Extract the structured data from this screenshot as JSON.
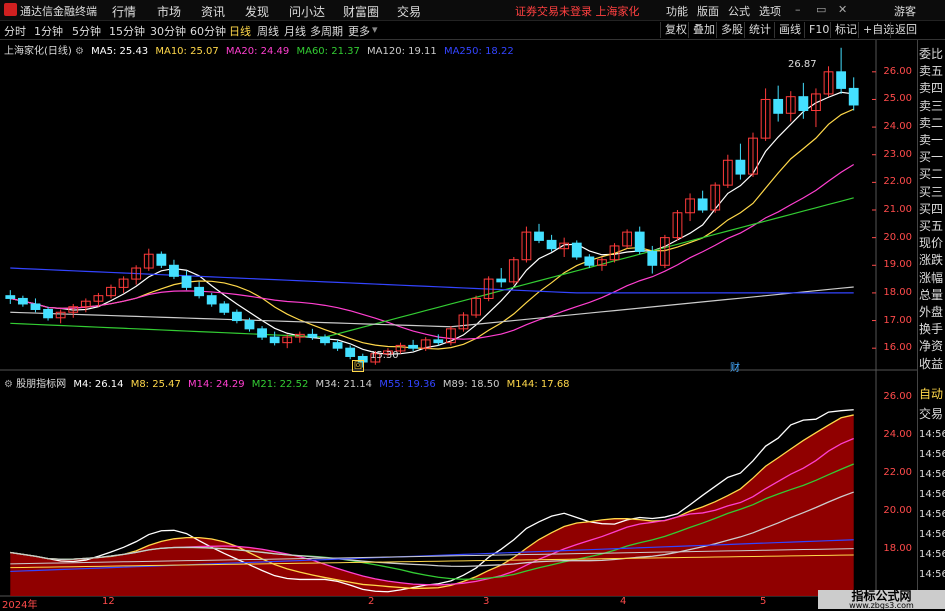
{
  "app": {
    "name": "通达信金融终端",
    "menu": [
      "行情",
      "市场",
      "资讯",
      "发现",
      "问小达",
      "财富圈",
      "交易"
    ],
    "notice": "证券交易未登录  上海家化",
    "right_menu": [
      "功能",
      "版面",
      "公式",
      "选项"
    ],
    "guest": "游客"
  },
  "toolbar": {
    "periods": [
      "分时",
      "1分钟",
      "5分钟",
      "15分钟",
      "30分钟",
      "60分钟",
      "日线",
      "周线",
      "月线",
      "多周期",
      "更多"
    ],
    "active_period": "日线",
    "buttons": [
      "复权",
      "叠加",
      "多股",
      "统计",
      "画线",
      "F10",
      "标记",
      "+自选",
      "返回"
    ]
  },
  "main_chart": {
    "stock": "上海家化(日线)",
    "ma_labels": [
      {
        "text": "MA5: 25.43",
        "color": "#ffffff"
      },
      {
        "text": "MA10: 25.07",
        "color": "#ffd84a"
      },
      {
        "text": "MA20: 24.49",
        "color": "#ff3fd0"
      },
      {
        "text": "MA60: 21.37",
        "color": "#33cc33"
      },
      {
        "text": "MA120: 19.11",
        "color": "#cccccc"
      },
      {
        "text": "MA250: 18.22",
        "color": "#3344ff"
      }
    ],
    "high_label": "26.87",
    "low_label": "15.30",
    "cai_label": "财",
    "y_ticks": [
      "26.00",
      "25.00",
      "24.00",
      "23.00",
      "22.00",
      "21.00",
      "20.00",
      "19.00",
      "18.00",
      "17.00",
      "16.00"
    ]
  },
  "indicator": {
    "name": "股朋指标网",
    "labels": [
      {
        "text": "M4: 26.14",
        "color": "#ffffff"
      },
      {
        "text": "M8: 25.47",
        "color": "#ffd84a"
      },
      {
        "text": "M14: 24.29",
        "color": "#ff3fd0"
      },
      {
        "text": "M21: 22.52",
        "color": "#33cc33"
      },
      {
        "text": "M34: 21.14",
        "color": "#cccccc"
      },
      {
        "text": "M55: 19.36",
        "color": "#3344ff"
      },
      {
        "text": "M89: 18.50",
        "color": "#cccccc"
      },
      {
        "text": "M144: 17.68",
        "color": "#ffd84a"
      }
    ],
    "y_ticks": [
      "26.00",
      "24.00",
      "22.00",
      "20.00",
      "18.00"
    ]
  },
  "x_axis": [
    "2024年",
    "12",
    "2",
    "3",
    "4",
    "5"
  ],
  "side_panel": [
    "委比",
    "卖五",
    "卖四",
    "卖三",
    "卖二",
    "卖一",
    "买一",
    "买二",
    "买三",
    "买四",
    "买五",
    "现价",
    "涨跌",
    "涨幅",
    "总量",
    "外盘",
    "换手",
    "净资",
    "收益"
  ],
  "side_panel2": [
    "自动",
    "交易",
    "14:56",
    "14:56",
    "14:56",
    "14:56",
    "14:56",
    "14:56",
    "14:56",
    "14:56"
  ],
  "watermark": {
    "line1": "指标公式网",
    "line2": "www.zbgs3.com"
  },
  "colors": {
    "up": "#ff3b3b",
    "down": "#44e0ff",
    "axis": "#ff4b4b"
  },
  "chart_data": {
    "type": "line",
    "title": "",
    "x_start": "2024-11-01",
    "candles": [
      [
        17.9,
        18.1,
        17.6,
        17.8
      ],
      [
        17.8,
        17.9,
        17.5,
        17.6
      ],
      [
        17.6,
        17.8,
        17.3,
        17.4
      ],
      [
        17.4,
        17.5,
        17.0,
        17.1
      ],
      [
        17.1,
        17.4,
        16.9,
        17.3
      ],
      [
        17.3,
        17.6,
        17.1,
        17.5
      ],
      [
        17.5,
        17.8,
        17.3,
        17.7
      ],
      [
        17.7,
        18.0,
        17.5,
        17.9
      ],
      [
        17.9,
        18.3,
        17.8,
        18.2
      ],
      [
        18.2,
        18.6,
        18.0,
        18.5
      ],
      [
        18.5,
        19.0,
        18.3,
        18.9
      ],
      [
        18.9,
        19.6,
        18.8,
        19.4
      ],
      [
        19.4,
        19.5,
        18.9,
        19.0
      ],
      [
        19.0,
        19.2,
        18.5,
        18.6
      ],
      [
        18.6,
        18.8,
        18.1,
        18.2
      ],
      [
        18.2,
        18.4,
        17.8,
        17.9
      ],
      [
        17.9,
        18.0,
        17.5,
        17.6
      ],
      [
        17.6,
        17.7,
        17.2,
        17.3
      ],
      [
        17.3,
        17.4,
        16.9,
        17.0
      ],
      [
        17.0,
        17.1,
        16.6,
        16.7
      ],
      [
        16.7,
        16.8,
        16.3,
        16.4
      ],
      [
        16.4,
        16.6,
        16.1,
        16.2
      ],
      [
        16.2,
        16.5,
        16.0,
        16.4
      ],
      [
        16.4,
        16.6,
        16.2,
        16.5
      ],
      [
        16.5,
        16.7,
        16.3,
        16.4
      ],
      [
        16.4,
        16.5,
        16.1,
        16.2
      ],
      [
        16.2,
        16.3,
        15.9,
        16.0
      ],
      [
        16.0,
        16.1,
        15.6,
        15.7
      ],
      [
        15.7,
        15.8,
        15.3,
        15.5
      ],
      [
        15.5,
        15.9,
        15.4,
        15.8
      ],
      [
        15.8,
        16.0,
        15.7,
        15.9
      ],
      [
        15.9,
        16.2,
        15.8,
        16.1
      ],
      [
        16.1,
        16.3,
        15.9,
        16.0
      ],
      [
        16.0,
        16.4,
        15.9,
        16.3
      ],
      [
        16.3,
        16.5,
        16.1,
        16.2
      ],
      [
        16.2,
        16.8,
        16.1,
        16.7
      ],
      [
        16.7,
        17.3,
        16.6,
        17.2
      ],
      [
        17.2,
        17.9,
        17.1,
        17.8
      ],
      [
        17.8,
        18.6,
        17.7,
        18.5
      ],
      [
        18.5,
        18.9,
        18.2,
        18.4
      ],
      [
        18.4,
        19.3,
        18.3,
        19.2
      ],
      [
        19.2,
        20.4,
        19.1,
        20.2
      ],
      [
        20.2,
        20.5,
        19.8,
        19.9
      ],
      [
        19.9,
        20.1,
        19.5,
        19.6
      ],
      [
        19.6,
        20.0,
        19.3,
        19.8
      ],
      [
        19.8,
        19.9,
        19.2,
        19.3
      ],
      [
        19.3,
        19.4,
        18.9,
        19.0
      ],
      [
        19.0,
        19.3,
        18.8,
        19.2
      ],
      [
        19.2,
        19.8,
        19.1,
        19.7
      ],
      [
        19.7,
        20.3,
        19.6,
        20.2
      ],
      [
        20.2,
        20.4,
        19.4,
        19.5
      ],
      [
        19.5,
        19.7,
        18.7,
        19.0
      ],
      [
        19.0,
        20.1,
        18.9,
        20.0
      ],
      [
        20.0,
        21.0,
        19.9,
        20.9
      ],
      [
        20.9,
        21.6,
        20.6,
        21.4
      ],
      [
        21.4,
        21.7,
        20.9,
        21.0
      ],
      [
        21.0,
        22.0,
        20.9,
        21.9
      ],
      [
        21.9,
        23.0,
        21.8,
        22.8
      ],
      [
        22.8,
        23.4,
        22.1,
        22.3
      ],
      [
        22.3,
        23.8,
        22.2,
        23.6
      ],
      [
        23.6,
        25.4,
        23.5,
        25.0
      ],
      [
        25.0,
        25.5,
        24.2,
        24.5
      ],
      [
        24.5,
        25.3,
        24.2,
        25.1
      ],
      [
        25.1,
        25.6,
        24.3,
        24.6
      ],
      [
        24.6,
        25.4,
        24.0,
        25.2
      ],
      [
        25.2,
        26.2,
        25.1,
        26.0
      ],
      [
        26.0,
        26.87,
        25.2,
        25.4
      ],
      [
        25.4,
        25.8,
        24.6,
        24.8
      ]
    ],
    "series_names": [
      "MA5",
      "MA10",
      "MA20",
      "MA60",
      "MA120",
      "MA250"
    ],
    "ylim": [
      15.5,
      26.5
    ],
    "indicator_ylim": [
      15.5,
      26.5
    ]
  }
}
